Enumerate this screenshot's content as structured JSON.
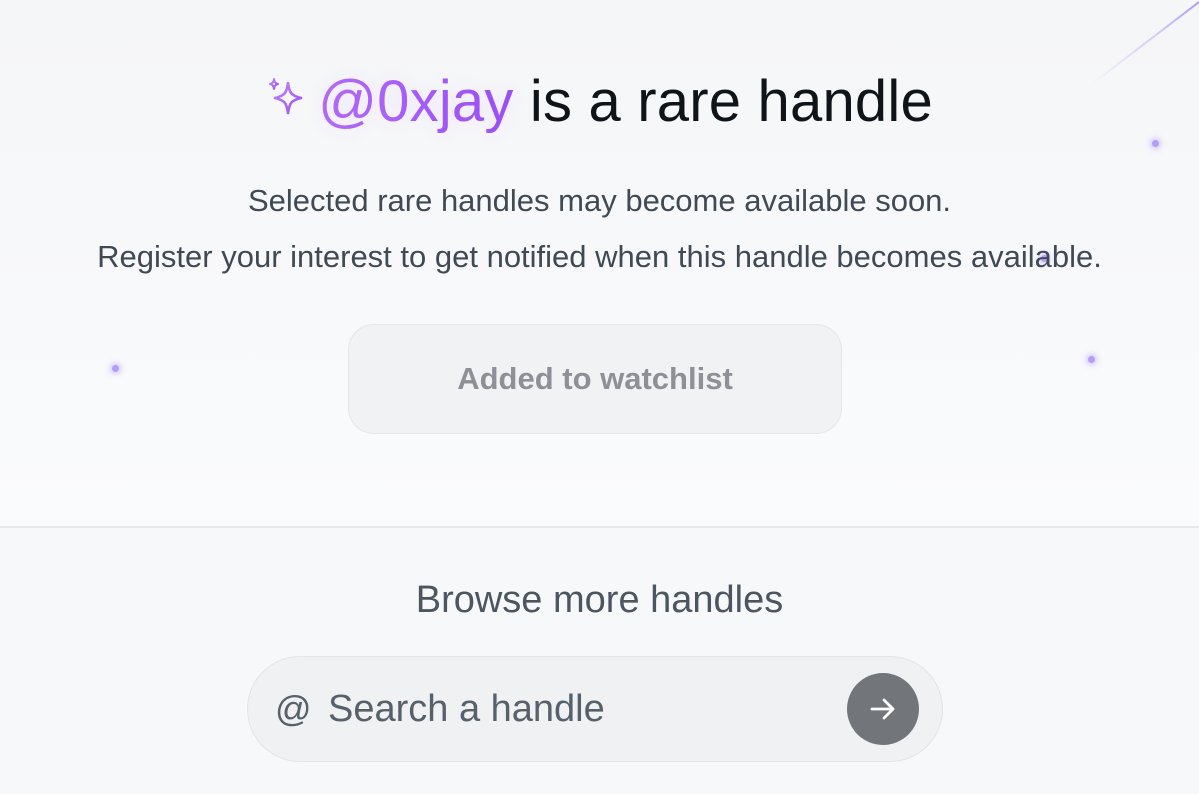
{
  "header": {
    "sparkle_icon": "sparkle-icon",
    "handle": "@0xjay",
    "title_suffix": "is a rare handle",
    "handle_color": "#a855f7"
  },
  "description": {
    "line1": "Selected rare handles may become available soon.",
    "line2": "Register your interest to get notified when this handle becomes available."
  },
  "watchlist_button": {
    "label": "Added to watchlist"
  },
  "browse": {
    "title": "Browse more handles",
    "search": {
      "prefix": "@",
      "value": "",
      "placeholder": "Search a handle",
      "submit_icon": "arrow-right-icon"
    }
  },
  "colors": {
    "accent": "#a855f7",
    "sparkle_dot": "#b59cf5",
    "go_button": "#72767b"
  }
}
